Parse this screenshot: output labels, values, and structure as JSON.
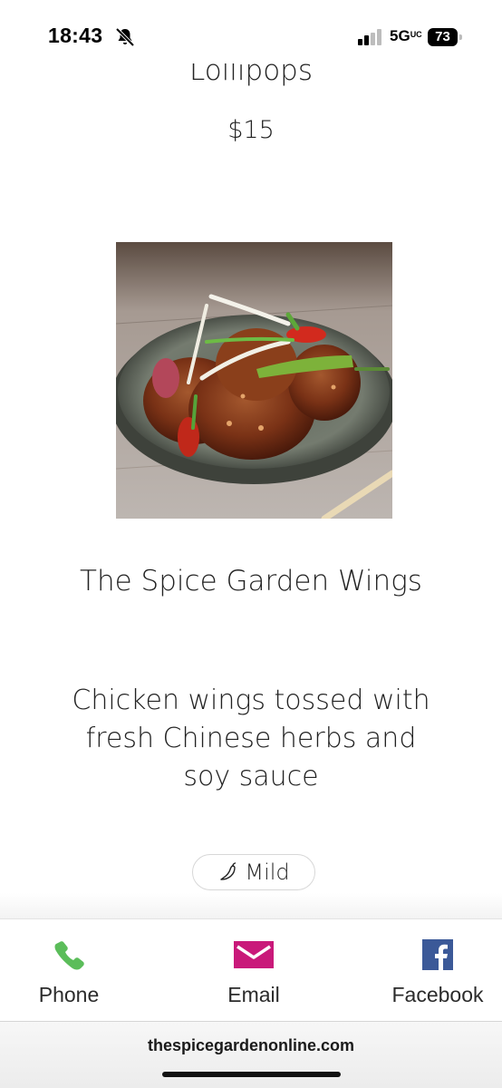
{
  "status_bar": {
    "time": "18:43",
    "network": "5G",
    "network_sup": "UC",
    "battery": "73",
    "icons": [
      "bell-slash-icon",
      "signal-icon",
      "battery-icon"
    ]
  },
  "menu": {
    "previous_item": {
      "title_fragment": "Lollipops",
      "price": "$15"
    },
    "item": {
      "name": "The Spice Garden Wings",
      "description": "Chicken wings tossed with fresh Chinese herbs and soy sauce",
      "spice_level": "Mild",
      "spice_icon": "chili-icon"
    }
  },
  "action_bar": {
    "phone_label": "Phone",
    "email_label": "Email",
    "facebook_label": "Facebook",
    "colors": {
      "phone": "#5bbd5a",
      "email": "#c9197a",
      "facebook": "#3b5998"
    }
  },
  "browser": {
    "url": "thespicegardenonline.com"
  }
}
